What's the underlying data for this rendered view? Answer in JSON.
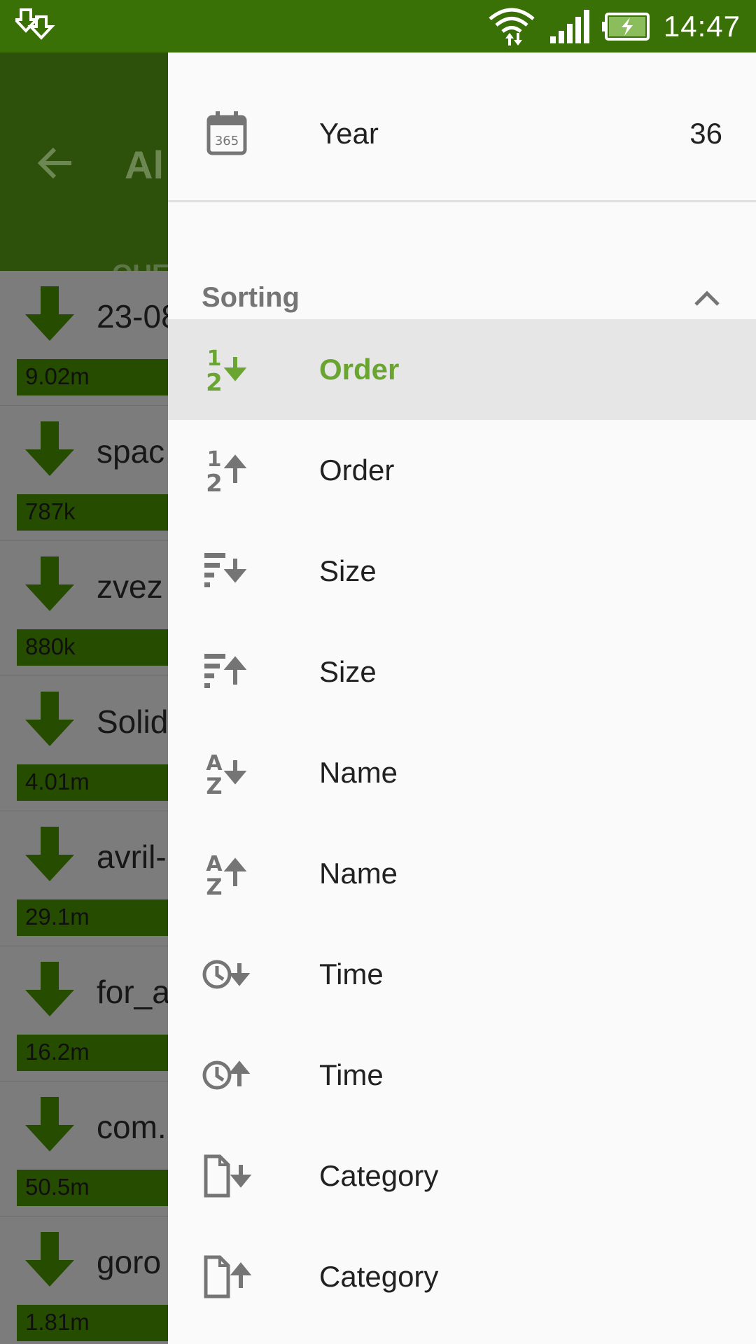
{
  "status_bar": {
    "time": "14:47",
    "icons": [
      "download-notification-icon",
      "wifi-icon",
      "signal-icon",
      "battery-charging-icon"
    ]
  },
  "app_bar": {
    "title": "Al",
    "tab": "QUE"
  },
  "downloads": [
    {
      "name": "23-08",
      "size": "9.02m"
    },
    {
      "name": "spac",
      "size": "787k"
    },
    {
      "name": "zvez",
      "size": "880k"
    },
    {
      "name": "Solid",
      "size": "4.01m"
    },
    {
      "name": "avril-",
      "size": "29.1m"
    },
    {
      "name": "for_a",
      "size": "16.2m"
    },
    {
      "name": "com.",
      "size": "50.5m"
    },
    {
      "name": "goro",
      "size": "1.81m"
    }
  ],
  "drawer": {
    "year": {
      "label": "Year",
      "value": "36",
      "icon": "calendar-365-icon"
    },
    "sorting": {
      "title": "Sorting",
      "items": [
        {
          "label": "Order",
          "icon": "order-descending-icon",
          "selected": true
        },
        {
          "label": "Order",
          "icon": "order-ascending-icon",
          "selected": false
        },
        {
          "label": "Size",
          "icon": "size-descending-icon",
          "selected": false
        },
        {
          "label": "Size",
          "icon": "size-ascending-icon",
          "selected": false
        },
        {
          "label": "Name",
          "icon": "name-descending-icon",
          "selected": false
        },
        {
          "label": "Name",
          "icon": "name-ascending-icon",
          "selected": false
        },
        {
          "label": "Time",
          "icon": "time-descending-icon",
          "selected": false
        },
        {
          "label": "Time",
          "icon": "time-ascending-icon",
          "selected": false
        },
        {
          "label": "Category",
          "icon": "category-descending-icon",
          "selected": false
        },
        {
          "label": "Category",
          "icon": "category-ascending-icon",
          "selected": false
        }
      ]
    }
  },
  "colors": {
    "status_bar": "#3a7106",
    "accent": "#6aa532",
    "icon_gray": "#757575"
  }
}
